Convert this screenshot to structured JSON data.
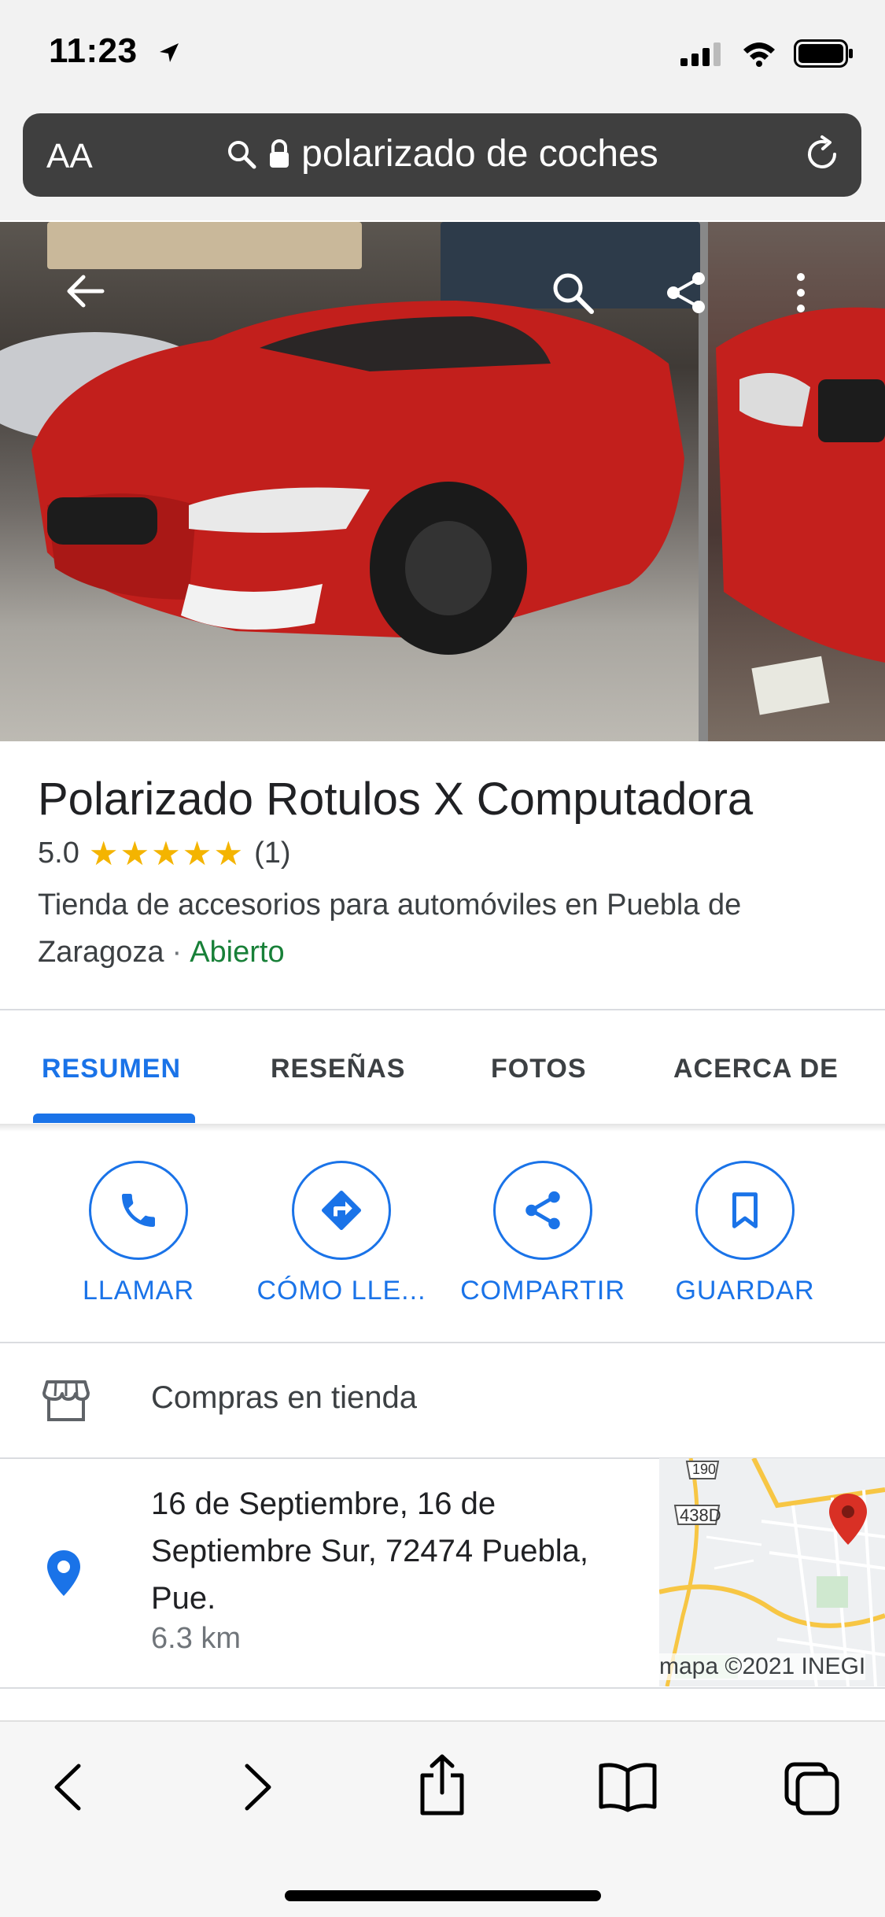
{
  "status_bar": {
    "time": "11:23"
  },
  "browser": {
    "text_size_label": "AA",
    "url_text": "polarizado de coches"
  },
  "place": {
    "title": "Polarizado Rotulos X Computadora",
    "rating": "5.0",
    "stars": "★★★★★",
    "rating_value": 5.0,
    "review_count": "(1)",
    "category": "Tienda de accesorios para automóviles en Puebla de Zaragoza",
    "separator": "·",
    "open_status": "Abierto"
  },
  "tabs": [
    {
      "label": "RESUMEN",
      "active": true
    },
    {
      "label": "RESEÑAS",
      "active": false
    },
    {
      "label": "FOTOS",
      "active": false
    },
    {
      "label": "ACERCA DE",
      "active": false
    }
  ],
  "actions": [
    {
      "label": "LLAMAR",
      "icon": "phone-icon"
    },
    {
      "label": "CÓMO LLE...",
      "icon": "directions-icon"
    },
    {
      "label": "COMPARTIR",
      "icon": "share-icon"
    },
    {
      "label": "GUARDAR",
      "icon": "bookmark-icon"
    }
  ],
  "info": {
    "service": "Compras en tienda",
    "address": "16 de Septiembre, 16 de Septiembre Sur, 72474 Puebla, Pue.",
    "distance": "6.3 km",
    "map_credit": "mapa ©2021 INEGI",
    "map_route_labels": [
      "190",
      "438D"
    ]
  },
  "colors": {
    "accent": "#1a73e8",
    "open_green": "#188038",
    "star_yellow": "#f4b400",
    "pin_red": "#d93025"
  }
}
